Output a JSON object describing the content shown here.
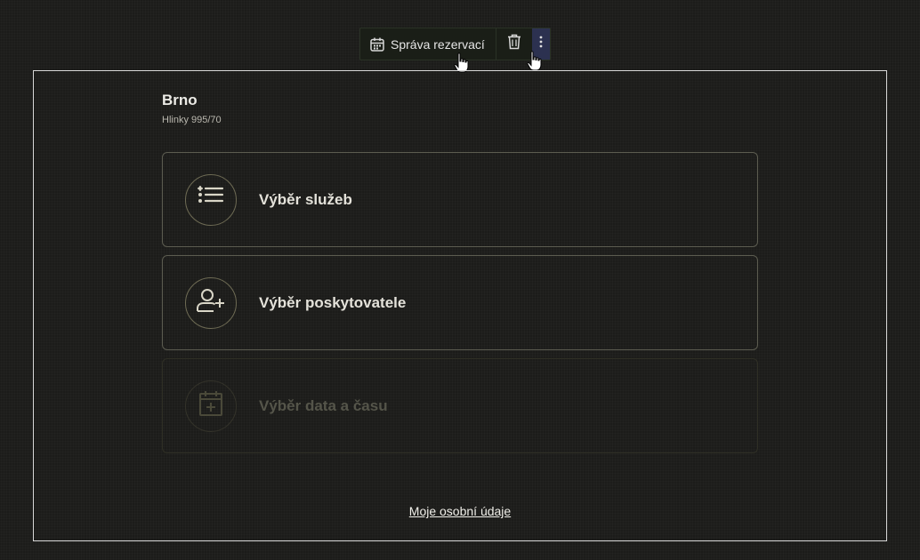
{
  "toolbar": {
    "block_label": "Správa rezervací",
    "block_icon": "calendar-icon",
    "delete_icon": "trash-icon",
    "more_icon": "more-vertical-icon"
  },
  "location": {
    "title": "Brno",
    "address": "Hlinky 995/70"
  },
  "steps": [
    {
      "label": "Výběr služeb",
      "icon": "list-icon",
      "enabled": true
    },
    {
      "label": "Výběr poskytovatele",
      "icon": "user-plus-icon",
      "enabled": true
    },
    {
      "label": "Výběr data a času",
      "icon": "calendar-plus-icon",
      "enabled": false
    }
  ],
  "footer": {
    "personal_data_link": "Moje osobní údaje"
  },
  "colors": {
    "background": "#1c1c1a",
    "accent_olive": "#6f6c55",
    "toolbar_more_bg": "#2c3150"
  }
}
